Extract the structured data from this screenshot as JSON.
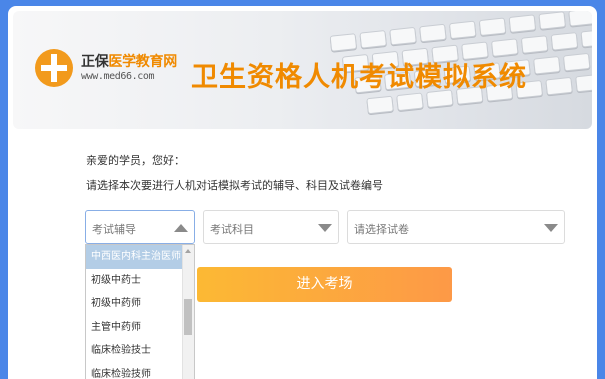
{
  "banner": {
    "logo_brand": "正保",
    "logo_brand_sub": "医学教育网",
    "logo_url": "www.med66.com",
    "title": "卫生资格人机考试模拟系统"
  },
  "intro": {
    "greeting": "亲爱的学员，您好：",
    "instruction": "请选择本次要进行人机对话模拟考试的辅导、科目及试卷编号"
  },
  "selects": {
    "course": "考试辅导",
    "subject": "考试科目",
    "paper": "请选择试卷"
  },
  "dropdown": {
    "options": [
      "中西医内科主治医师",
      "初级中药士",
      "初级中药师",
      "主管中药师",
      "临床检验技士",
      "临床检验技师"
    ],
    "selected_index": 0
  },
  "enter_button": "进入考场",
  "colors": {
    "background": "#4a86e8",
    "accent": "#f08a00",
    "button_start": "#fcb934",
    "button_end": "#fd9947",
    "selected_option": "#b3cde6"
  }
}
